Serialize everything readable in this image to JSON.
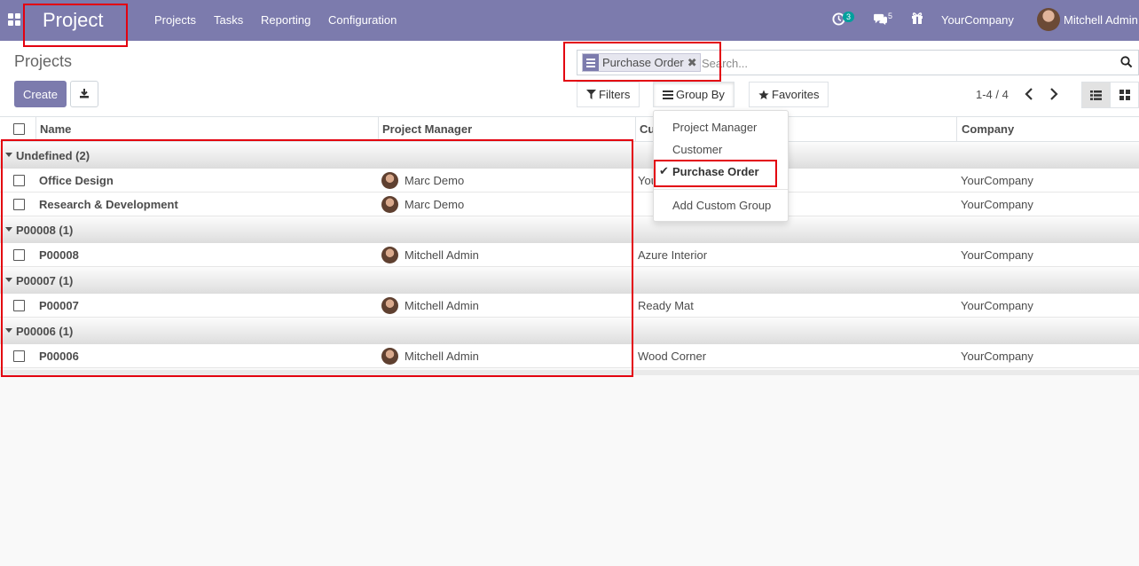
{
  "navbar": {
    "brand": "Project",
    "menu": [
      "Projects",
      "Tasks",
      "Reporting",
      "Configuration"
    ],
    "activity_count": "3",
    "message_count": "5",
    "company": "YourCompany",
    "user": "Mitchell Admin",
    "icons": [
      "apps-icon",
      "clock-icon",
      "chat-icon",
      "gift-icon"
    ],
    "color": "#7c7bad"
  },
  "control_panel": {
    "breadcrumb": "Projects",
    "create_label": "Create",
    "search": {
      "facet": "Purchase Order",
      "placeholder": "Search..."
    },
    "filters_label": "Filters",
    "group_by_label": "Group By",
    "favorites_label": "Favorites",
    "pager": "1-4 / 4"
  },
  "group_by_menu": {
    "items": [
      "Project Manager",
      "Customer",
      "Purchase Order"
    ],
    "checked": "Purchase Order",
    "custom": "Add Custom Group"
  },
  "list": {
    "columns": [
      "Name",
      "Project Manager",
      "Cu",
      "Company"
    ],
    "groups": [
      {
        "label": "Undefined (2)",
        "rows": [
          {
            "name": "Office Design",
            "manager": "Marc Demo",
            "customer": "You",
            "company": "YourCompany"
          },
          {
            "name": "Research & Development",
            "manager": "Marc Demo",
            "customer": "",
            "company": "YourCompany"
          }
        ]
      },
      {
        "label": "P00008 (1)",
        "rows": [
          {
            "name": "P00008",
            "manager": "Mitchell Admin",
            "customer": "Azure Interior",
            "company": "YourCompany"
          }
        ]
      },
      {
        "label": "P00007 (1)",
        "rows": [
          {
            "name": "P00007",
            "manager": "Mitchell Admin",
            "customer": "Ready Mat",
            "company": "YourCompany"
          }
        ]
      },
      {
        "label": "P00006 (1)",
        "rows": [
          {
            "name": "P00006",
            "manager": "Mitchell Admin",
            "customer": "Wood Corner",
            "company": "YourCompany"
          }
        ]
      }
    ]
  }
}
